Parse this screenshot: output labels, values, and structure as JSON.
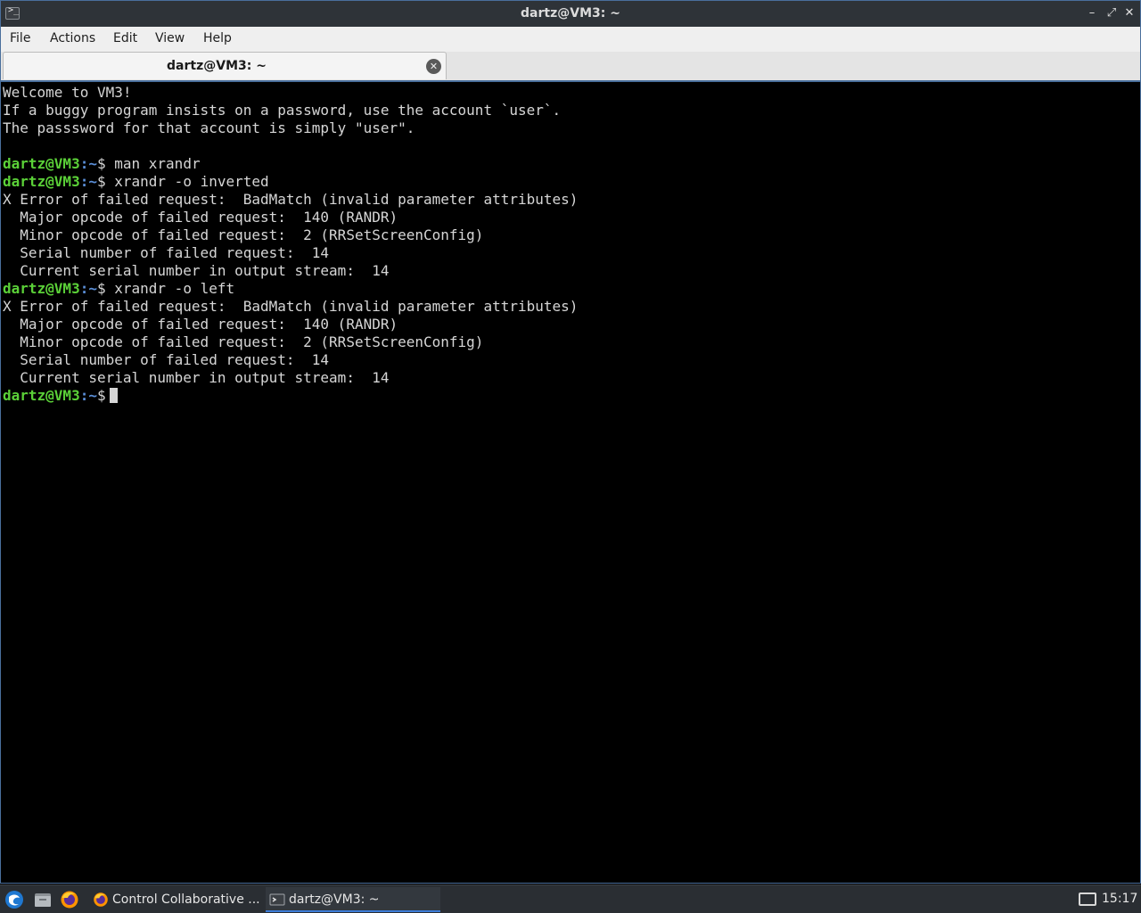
{
  "window": {
    "title": "dartz@VM3: ~"
  },
  "menubar": {
    "items": [
      "File",
      "Actions",
      "Edit",
      "View",
      "Help"
    ]
  },
  "tab": {
    "label": "dartz@VM3: ~"
  },
  "terminal": {
    "motd": [
      "Welcome to VM3!",
      "If a buggy program insists on a password, use the account `user`.",
      "The passsword for that account is simply \"user\"."
    ],
    "prompt_user": "dartz@VM3",
    "prompt_path": "~",
    "blocks": [
      {
        "command": "man xrandr",
        "output": []
      },
      {
        "command": "xrandr -o inverted",
        "output": [
          "X Error of failed request:  BadMatch (invalid parameter attributes)",
          "  Major opcode of failed request:  140 (RANDR)",
          "  Minor opcode of failed request:  2 (RRSetScreenConfig)",
          "  Serial number of failed request:  14",
          "  Current serial number in output stream:  14"
        ]
      },
      {
        "command": "xrandr -o left",
        "output": [
          "X Error of failed request:  BadMatch (invalid parameter attributes)",
          "  Major opcode of failed request:  140 (RANDR)",
          "  Minor opcode of failed request:  2 (RRSetScreenConfig)",
          "  Serial number of failed request:  14",
          "  Current serial number in output stream:  14"
        ]
      }
    ]
  },
  "taskbar": {
    "tasks": [
      {
        "label": "Control Collaborative ...",
        "icon": "firefox-icon"
      },
      {
        "label": "dartz@VM3: ~",
        "icon": "terminal-icon"
      }
    ],
    "clock": "15:17"
  },
  "colors": {
    "prompt_user": "#5bd138",
    "prompt_path": "#5b8fd8",
    "window_border": "#4a6f9c"
  }
}
